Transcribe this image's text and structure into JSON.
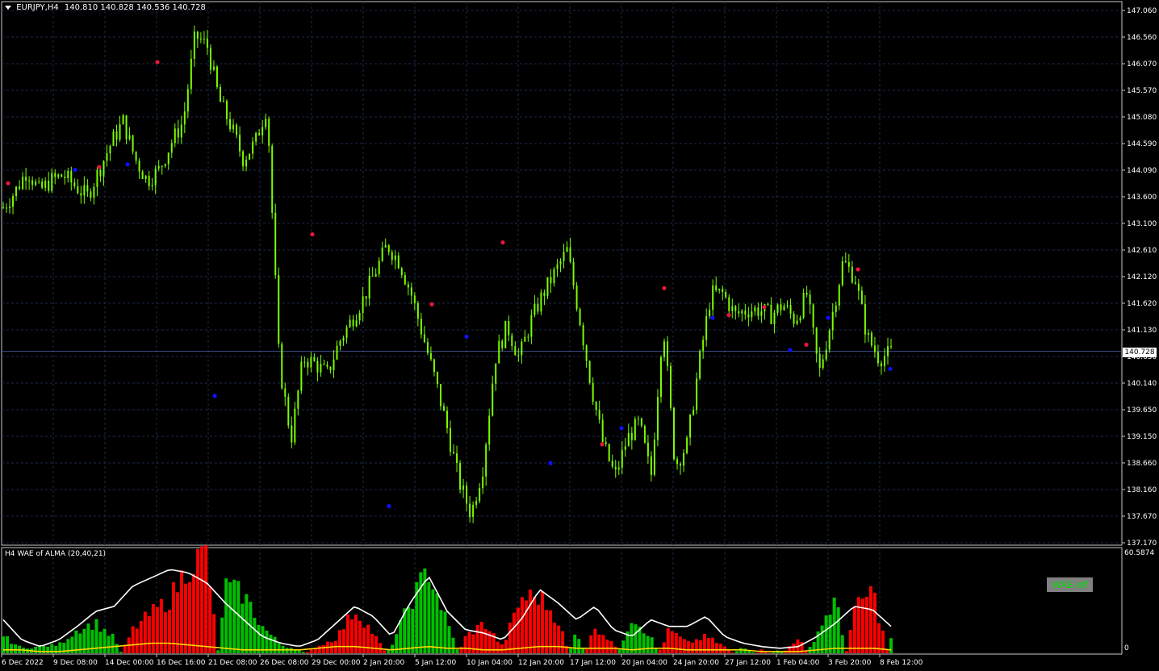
{
  "header": {
    "symbol_tf": "EURJPY,H4",
    "ohlc": "140.810 140.828 140.536 140.728",
    "dropdown_icon": "triangle-down-icon"
  },
  "indicator": {
    "title": "H4 WAE of ALMA (20,40,21)",
    "scale_max": "60.5874",
    "scale_min": "0",
    "button_label": "WAE-off"
  },
  "current_price": "140.728",
  "price_axis": [
    "147.060",
    "146.560",
    "146.070",
    "145.570",
    "145.080",
    "144.590",
    "144.090",
    "143.600",
    "143.100",
    "142.610",
    "142.120",
    "141.620",
    "141.130",
    "140.630",
    "140.140",
    "139.650",
    "139.150",
    "138.660",
    "138.160",
    "137.670",
    "137.170"
  ],
  "time_axis": [
    "6 Dec 2022",
    "9 Dec 08:00",
    "14 Dec 00:00",
    "16 Dec 16:00",
    "21 Dec 08:00",
    "26 Dec 08:00",
    "29 Dec 00:00",
    "2 Jan 20:00",
    "5 Jan 12:00",
    "10 Jan 04:00",
    "12 Jan 20:00",
    "17 Jan 12:00",
    "20 Jan 04:00",
    "24 Jan 20:00",
    "27 Jan 12:00",
    "1 Feb 04:00",
    "3 Feb 20:00",
    "8 Feb 12:00"
  ],
  "colors": {
    "background": "#000000",
    "grid": "#1c2a4a",
    "candles": "#7cfc00",
    "sell_dot": "#e8173a",
    "buy_dot": "#1010ff",
    "wae_up": "#00c000",
    "wae_down": "#ff0000",
    "explosion_line": "#ffffff",
    "dead_zone": "#ffd700",
    "price_line": "#3a4a8a"
  },
  "chart_data": {
    "type": "line",
    "title": "EURJPY,H4",
    "ylim": [
      137.17,
      147.06
    ],
    "close_path": [
      143.4,
      143.7,
      144.1,
      143.7,
      143.9,
      144.0,
      143.8,
      143.6,
      144.1,
      144.6,
      145.0,
      144.3,
      143.9,
      144.1,
      144.6,
      145.0,
      146.6,
      146.4,
      145.4,
      144.9,
      144.3,
      144.6,
      145.3,
      140.5,
      139.1,
      140.6,
      140.5,
      140.3,
      140.9,
      141.3,
      141.7,
      142.2,
      142.7,
      142.4,
      141.8,
      141.0,
      140.2,
      139.3,
      138.3,
      137.7,
      138.6,
      140.6,
      141.2,
      140.6,
      141.3,
      141.8,
      142.2,
      142.6,
      141.4,
      140.1,
      139.0,
      138.4,
      139.1,
      139.4,
      138.4,
      141.3,
      138.6,
      139.0,
      140.5,
      141.8,
      141.8,
      141.4,
      141.5,
      141.5,
      141.4,
      141.6,
      141.3,
      141.8,
      140.3,
      141.3,
      142.4,
      142.1,
      141.0,
      140.6,
      140.7
    ],
    "sell_signals": [
      143.85,
      144.15,
      146.1,
      142.9,
      141.6,
      142.75,
      139.0,
      141.9,
      141.4,
      141.55,
      140.85,
      142.25
    ],
    "buy_signals": [
      144.1,
      144.2,
      139.9,
      137.85,
      141.0,
      138.65,
      139.3,
      141.35,
      140.75,
      141.35,
      140.4
    ],
    "wae": {
      "ylim": [
        0,
        60.5874
      ],
      "trend": [
        10,
        3,
        4,
        5,
        14,
        18,
        9,
        -14,
        -24,
        -32,
        -52,
        -60,
        40,
        35,
        16,
        5,
        2,
        -4,
        -9,
        -26,
        -12,
        5,
        30,
        50,
        18,
        -10,
        -18,
        -4,
        -33,
        -34,
        -20,
        14,
        -16,
        -6,
        22,
        10,
        -14,
        -6,
        -10,
        -4,
        4,
        -2,
        2,
        -10,
        12,
        32,
        -25,
        -38,
        8
      ],
      "explosion": [
        20,
        8,
        4,
        8,
        16,
        25,
        28,
        40,
        45,
        50,
        48,
        42,
        30,
        20,
        10,
        6,
        4,
        8,
        18,
        28,
        22,
        10,
        30,
        46,
        25,
        14,
        12,
        8,
        20,
        38,
        30,
        20,
        28,
        14,
        10,
        20,
        16,
        16,
        22,
        10,
        6,
        4,
        3,
        4,
        10,
        18,
        28,
        26,
        16
      ],
      "deadzone": [
        2,
        2,
        1,
        1,
        2,
        3,
        4,
        5,
        6,
        6,
        5,
        4,
        3,
        2,
        2,
        2,
        2,
        3,
        4,
        4,
        3,
        2,
        3,
        4,
        3,
        3,
        2,
        2,
        3,
        4,
        4,
        3,
        3,
        3,
        2,
        3,
        3,
        2,
        2,
        2,
        2,
        1,
        1,
        1,
        2,
        3,
        3,
        3,
        2
      ]
    }
  }
}
